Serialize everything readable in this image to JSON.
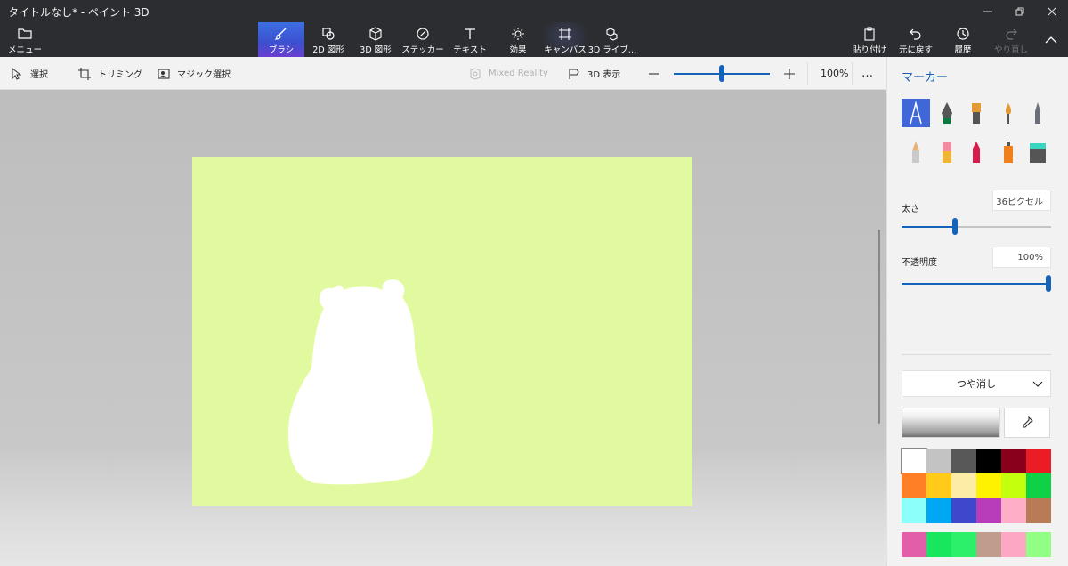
{
  "window": {
    "title": "タイトルなし* - ペイント 3D",
    "controls": [
      "minimize-icon",
      "restore-icon",
      "close-icon"
    ]
  },
  "ribbon": {
    "menu_label": "メニュー",
    "tabs": [
      {
        "label": "ブラシ",
        "icon": "brush-icon",
        "active": true
      },
      {
        "label": "2D 図形",
        "icon": "2d-shapes-icon"
      },
      {
        "label": "3D 図形",
        "icon": "3d-shapes-icon"
      },
      {
        "label": "ステッカー",
        "icon": "sticker-icon"
      },
      {
        "label": "テキスト",
        "icon": "text-icon"
      },
      {
        "label": "効果",
        "icon": "effects-icon"
      },
      {
        "label": "キャンバス",
        "icon": "canvas-icon"
      },
      {
        "label": "3D ライブ…",
        "icon": "3d-library-icon"
      }
    ],
    "right_buttons": [
      {
        "label": "貼り付け",
        "icon": "paste-icon"
      },
      {
        "label": "元に戻す",
        "icon": "undo-icon"
      },
      {
        "label": "履歴",
        "icon": "history-icon"
      },
      {
        "label": "やり直し",
        "icon": "redo-icon",
        "disabled": true
      }
    ]
  },
  "toolbar": {
    "select_label": "選択",
    "crop_label": "トリミング",
    "magic_select_label": "マジック選択",
    "mixed_reality_label": "Mixed Reality",
    "view3d_label": "3D 表示",
    "zoom_percent": "100%",
    "zoom_level": 0.5,
    "more": "…"
  },
  "canvas": {
    "background_color": "#e2fa9f",
    "shape_color": "#ffffff",
    "shape": "white bear silhouette"
  },
  "panel": {
    "title": "マーカー",
    "brushes": [
      {
        "name": "marker-icon",
        "active": true
      },
      {
        "name": "calligraphy-pen-icon"
      },
      {
        "name": "oil-brush-icon"
      },
      {
        "name": "watercolor-icon"
      },
      {
        "name": "pixel-pen-icon"
      },
      {
        "name": "pencil-icon"
      },
      {
        "name": "eraser-icon"
      },
      {
        "name": "crayon-icon"
      },
      {
        "name": "spray-can-icon"
      },
      {
        "name": "fill-bucket-icon"
      }
    ],
    "thickness_label": "太さ",
    "thickness_value": "36ピクセル",
    "thickness_level": 0.36,
    "opacity_label": "不透明度",
    "opacity_value": "100%",
    "opacity_level": 1.0,
    "finish_label": "つや消し",
    "accent_color": "#1463b8",
    "palette": [
      "#ffffff",
      "#c3c3c3",
      "#585858",
      "#000000",
      "#88001b",
      "#ec1c24",
      "#ff7f27",
      "#ffca18",
      "#fdeca6",
      "#fff200",
      "#c4ff0e",
      "#0ed145",
      "#8cfffb",
      "#00a8f3",
      "#3f48cc",
      "#b83dba",
      "#ffaec8",
      "#b97a56",
      "#e25ea8",
      "#19e65f",
      "#2df06a",
      "#bf9c8c",
      "#fca7c3",
      "#90ff83"
    ]
  }
}
